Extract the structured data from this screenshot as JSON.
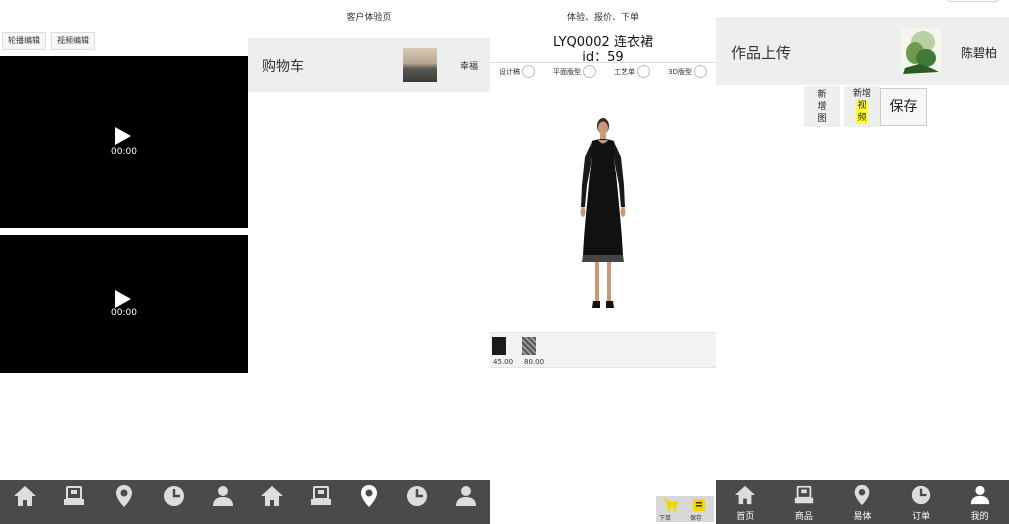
{
  "panel1": {
    "tabs": [
      "轮播编辑",
      "视频编辑"
    ],
    "videos": [
      {
        "time": "00:00"
      },
      {
        "time": "00:00"
      }
    ],
    "nav": [
      {
        "icon": "home-icon",
        "label": ""
      },
      {
        "icon": "goods-icon",
        "label": ""
      },
      {
        "icon": "location-icon",
        "label": ""
      },
      {
        "icon": "clock-icon",
        "label": ""
      },
      {
        "icon": "user-icon",
        "label": ""
      }
    ]
  },
  "panel2": {
    "page_title": "客户体验页",
    "cart_title": "购物车",
    "user_name": "幸福",
    "nav": [
      {
        "icon": "home-icon",
        "label": ""
      },
      {
        "icon": "goods-icon",
        "label": ""
      },
      {
        "icon": "location-icon",
        "label": "",
        "active": true
      },
      {
        "icon": "clock-icon",
        "label": ""
      },
      {
        "icon": "user-icon",
        "label": ""
      }
    ]
  },
  "panel3": {
    "header": "体验、报价、下单",
    "product_code": "LYQ0002 连衣裙",
    "product_id": "id：59",
    "options": [
      "设计稿",
      "平面版型",
      "工艺单",
      "3D版型"
    ],
    "swatches": [
      {
        "price": "45.00",
        "color": "#1a1a1a"
      },
      {
        "price": "80.00",
        "color": "#777777"
      }
    ],
    "actions": [
      {
        "icon": "cart-icon",
        "label": "下单",
        "color": "#f0d800"
      },
      {
        "icon": "doc-icon",
        "label": "保存",
        "color": "#f0d800"
      }
    ]
  },
  "panel4": {
    "title": "作品上传",
    "user_name": "陈碧柏",
    "add_image_label": "新增图",
    "add_video_prefix": "新增",
    "add_video_highlight": "视频",
    "save_label": "保存",
    "nav": [
      {
        "icon": "home-icon",
        "label": "首页"
      },
      {
        "icon": "goods-icon",
        "label": "商品"
      },
      {
        "icon": "location-icon",
        "label": "易体"
      },
      {
        "icon": "clock-icon",
        "label": "订单"
      },
      {
        "icon": "user-icon",
        "label": "我的",
        "active": true
      }
    ]
  },
  "colors": {
    "nav_bg": "#4a4a4a",
    "nav_icon": "#dddddd",
    "nav_active": "#ffffff",
    "highlight": "#ffff33"
  }
}
